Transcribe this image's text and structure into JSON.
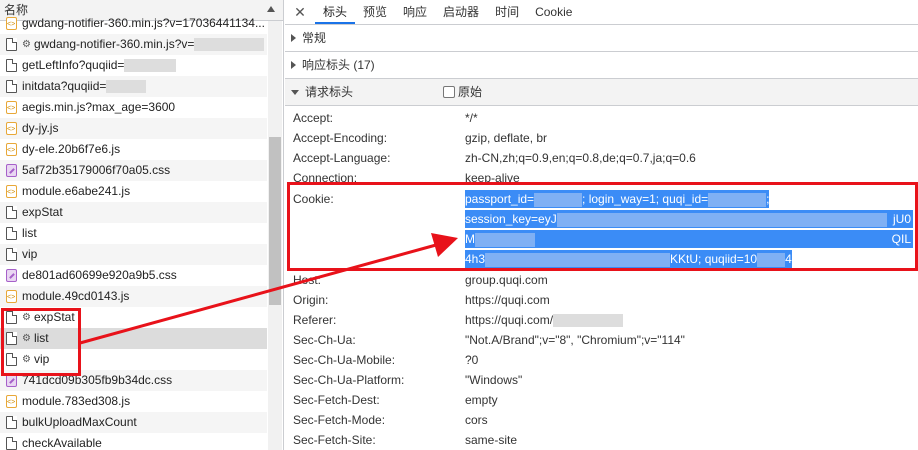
{
  "left_panel": {
    "header": "名称",
    "rows": [
      {
        "icon": "js",
        "name": "gwdang-notifier-360.min.js?v=17036441134...",
        "gear": false
      },
      {
        "icon": "doc",
        "name": "gwdang-notifier-360.min.js?v=",
        "gear": true
      },
      {
        "icon": "doc",
        "name": "getLeftInfo?quqiid=",
        "gear": false
      },
      {
        "icon": "doc",
        "name": "initdata?quqiid=",
        "gear": false
      },
      {
        "icon": "js",
        "name": "aegis.min.js?max_age=3600",
        "gear": false
      },
      {
        "icon": "js",
        "name": "dy-jy.js",
        "gear": false
      },
      {
        "icon": "js",
        "name": "dy-ele.20b6f7e6.js",
        "gear": false
      },
      {
        "icon": "css",
        "name": "5af72b35179006f70a05.css",
        "gear": false
      },
      {
        "icon": "js",
        "name": "module.e6abe241.js",
        "gear": false
      },
      {
        "icon": "doc",
        "name": "expStat",
        "gear": false
      },
      {
        "icon": "doc",
        "name": "list",
        "gear": false
      },
      {
        "icon": "doc",
        "name": "vip",
        "gear": false
      },
      {
        "icon": "css",
        "name": "de801ad60699e920a9b5.css",
        "gear": false
      },
      {
        "icon": "js",
        "name": "module.49cd0143.js",
        "gear": false
      },
      {
        "icon": "doc",
        "name": "expStat",
        "gear": true
      },
      {
        "icon": "doc",
        "name": "list",
        "gear": true
      },
      {
        "icon": "doc",
        "name": "vip",
        "gear": true
      },
      {
        "icon": "css",
        "name": "741dcd09b305fb9b34dc.css",
        "gear": false
      },
      {
        "icon": "js",
        "name": "module.783ed308.js",
        "gear": false
      },
      {
        "icon": "doc",
        "name": "bulkUploadMaxCount",
        "gear": false
      },
      {
        "icon": "doc",
        "name": "checkAvailable",
        "gear": false
      }
    ]
  },
  "right_panel": {
    "tabs": [
      "标头",
      "预览",
      "响应",
      "启动器",
      "时间",
      "Cookie"
    ],
    "active_tab": "标头",
    "sections": {
      "general": "常规",
      "response_headers": "响应标头 (17)",
      "request_headers": "请求标头",
      "raw_label": "原始"
    },
    "headers": [
      {
        "name": "Accept:",
        "value": "*/*"
      },
      {
        "name": "Accept-Encoding:",
        "value": "gzip, deflate, br"
      },
      {
        "name": "Accept-Language:",
        "value": "zh-CN,zh;q=0.9,en;q=0.8,de;q=0.7,ja;q=0.6"
      },
      {
        "name": "Connection:",
        "value": "keep-alive"
      }
    ],
    "cookie": {
      "name": "Cookie:",
      "line1a": "passport_id=",
      "line1b": "; login_way=1; quqi_id=",
      "line1c": ";",
      "line2a": "session_key=eyJ",
      "line2b": "jU0",
      "line3a": "M",
      "line3b": "QIL",
      "line4a": "4h3",
      "line4b": "KKtU; quqiid=10",
      "line4c": "4"
    },
    "headers2": [
      {
        "name": "Host:",
        "value": "group.quqi.com"
      },
      {
        "name": "Origin:",
        "value": "https://quqi.com"
      },
      {
        "name": "Referer:",
        "value": "https://quqi.com/"
      },
      {
        "name": "Sec-Ch-Ua:",
        "value": "\"Not.A/Brand\";v=\"8\", \"Chromium\";v=\"114\""
      },
      {
        "name": "Sec-Ch-Ua-Mobile:",
        "value": "?0"
      },
      {
        "name": "Sec-Ch-Ua-Platform:",
        "value": "\"Windows\""
      },
      {
        "name": "Sec-Fetch-Dest:",
        "value": "empty"
      },
      {
        "name": "Sec-Fetch-Mode:",
        "value": "cors"
      },
      {
        "name": "Sec-Fetch-Site:",
        "value": "same-site"
      }
    ]
  },
  "colors": {
    "highlight": "#e8121a",
    "selection": "#3b8cf6",
    "accent": "#1a73e8"
  }
}
